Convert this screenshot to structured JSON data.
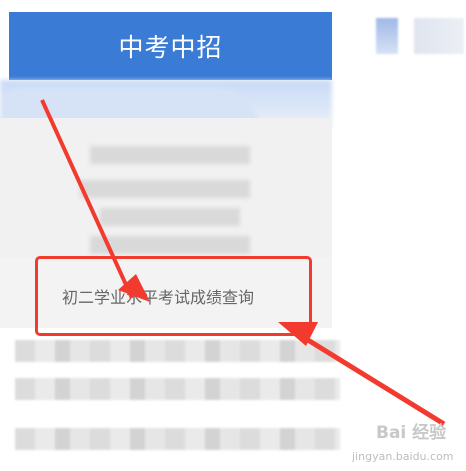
{
  "header": {
    "title": "中考中招"
  },
  "highlighted_item": {
    "label": "初二学业水平考试成绩查询"
  },
  "watermark": {
    "text": "Bai 经验",
    "sub": "jingyan.baidu.com"
  },
  "colors": {
    "header_bg": "#3a7bd5",
    "highlight_border": "#f23a2f",
    "arrow": "#f23a2f"
  },
  "icons": {
    "arrow_1": "red-arrow-icon",
    "arrow_2": "red-arrow-icon"
  }
}
